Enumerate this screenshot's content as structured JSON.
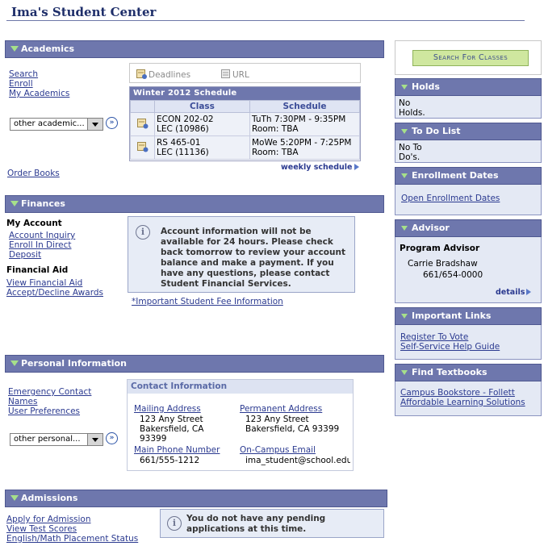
{
  "page": {
    "title": "Ima's Student Center"
  },
  "academics": {
    "header": "Academics",
    "links": [
      "Search",
      "Enroll",
      "My Academics"
    ],
    "dropdown_value": "other academic...",
    "order_books": "Order Books",
    "tabs": {
      "deadlines": "Deadlines",
      "url": "URL"
    },
    "schedule": {
      "caption": "Winter 2012 Schedule",
      "columns": [
        "Class",
        "Schedule"
      ],
      "rows": [
        {
          "class_line1": "ECON 202-02",
          "class_line2": "LEC (10986)",
          "sched_line1": "TuTh 7:30PM - 9:35PM",
          "sched_line2": "Room:  TBA"
        },
        {
          "class_line1": "RS 465-01",
          "class_line2": "LEC (11136)",
          "sched_line1": "MoWe 5:20PM - 7:25PM",
          "sched_line2": "Room:  TBA"
        }
      ],
      "weekly_link": "weekly schedule"
    }
  },
  "finances": {
    "header": "Finances",
    "my_account_label": "My Account",
    "my_account_links": [
      "Account Inquiry",
      "Enroll In Direct",
      "Deposit"
    ],
    "financial_aid_label": "Financial Aid",
    "financial_aid_links": [
      "View Financial Aid",
      "Accept/Decline Awards"
    ],
    "notice": "Account information will not be available for 24 hours. Please check back tomorrow to review your account balance and make a payment. If you have any questions, please contact Student Financial Services.",
    "fee_link": "*Important Student Fee Information"
  },
  "personal": {
    "header": "Personal Information",
    "links": [
      "Emergency Contact",
      "Names",
      "User Preferences"
    ],
    "dropdown_value": "other personal...",
    "contact": {
      "caption": "Contact Information",
      "mailing_label": "Mailing Address",
      "mailing_lines": [
        "123 Any Street",
        "Bakersfield, CA",
        "93399"
      ],
      "permanent_label": "Permanent Address",
      "permanent_lines": [
        "123 Any Street",
        "Bakersfield, CA 93399"
      ],
      "phone_label": "Main Phone Number",
      "phone_value": "661/555-1212",
      "email_label": "On-Campus Email",
      "email_value": "ima_student@school.edu"
    }
  },
  "admissions": {
    "header": "Admissions",
    "links": [
      "Apply for Admission",
      "View Test Scores",
      "English/Math Placement Status"
    ],
    "notice": "You do not have any pending applications at this time."
  },
  "sidebar": {
    "search_button": "Search For Classes",
    "holds": {
      "header": "Holds",
      "text_line1": "No",
      "text_line2": "Holds."
    },
    "todo": {
      "header": "To Do List",
      "text_line1": "No To",
      "text_line2": "Do's."
    },
    "enrollment": {
      "header": "Enrollment Dates",
      "link": "Open Enrollment Dates"
    },
    "advisor": {
      "header": "Advisor",
      "role": "Program Advisor",
      "name": "Carrie Bradshaw",
      "phone": "661/654-0000",
      "details": "details"
    },
    "important_links": {
      "header": "Important Links",
      "links": [
        "Register To Vote",
        "Self-Service Help Guide"
      ]
    },
    "textbooks": {
      "header": "Find Textbooks",
      "links": [
        "Campus Bookstore - Follett",
        "Affordable Learning Solutions"
      ]
    }
  },
  "colors": {
    "header_bg": "#6e77ad",
    "link": "#2b3a90",
    "search_button_bg": "#cfe79f",
    "panel_bg": "#e4e9f4"
  }
}
